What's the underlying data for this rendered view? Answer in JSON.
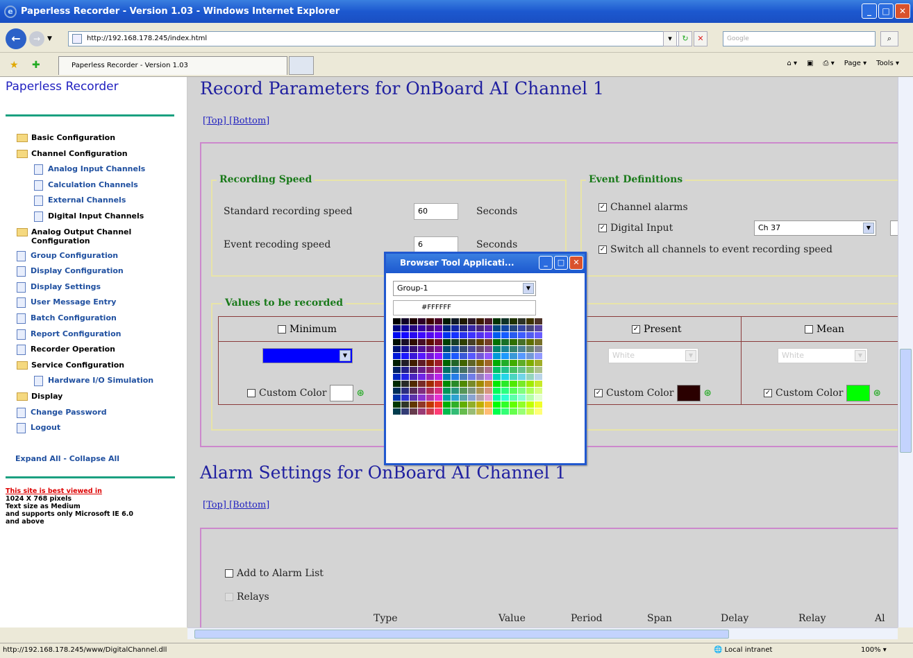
{
  "window": {
    "title": "Paperless Recorder - Version 1.03 - Windows Internet Explorer"
  },
  "address": {
    "url": "http://192.168.178.245/index.html",
    "search_placeholder": "Google"
  },
  "tab": {
    "label": "Paperless Recorder - Version 1.03"
  },
  "commands": {
    "page": "Page",
    "tools": "Tools"
  },
  "sidebar": {
    "title": "Paperless Recorder",
    "items": [
      {
        "label": "Basic Configuration",
        "level": 0,
        "icon": "folder-icon",
        "color": "#000000"
      },
      {
        "label": "Channel Configuration",
        "level": 0,
        "icon": "folder-open-icon",
        "color": "#000000"
      },
      {
        "label": "Analog Input Channels",
        "level": 1,
        "icon": "document-icon",
        "color": "#2050a0"
      },
      {
        "label": "Calculation Channels",
        "level": 1,
        "icon": "document-icon",
        "color": "#2050a0"
      },
      {
        "label": "External Channels",
        "level": 1,
        "icon": "document-icon",
        "color": "#2050a0"
      },
      {
        "label": "Digital Input Channels",
        "level": 1,
        "icon": "document-icon",
        "color": "#000000"
      },
      {
        "label": "Analog Output Channel Configuration",
        "level": 0,
        "icon": "folder-icon",
        "color": "#000000"
      },
      {
        "label": "Group Configuration",
        "level": 0,
        "icon": "document-icon",
        "color": "#2050a0"
      },
      {
        "label": "Display Configuration",
        "level": 0,
        "icon": "document-icon",
        "color": "#2050a0"
      },
      {
        "label": "Display Settings",
        "level": 0,
        "icon": "document-icon",
        "color": "#2050a0"
      },
      {
        "label": "User Message Entry",
        "level": 0,
        "icon": "document-icon",
        "color": "#2050a0"
      },
      {
        "label": "Batch Configuration",
        "level": 0,
        "icon": "document-icon",
        "color": "#2050a0"
      },
      {
        "label": "Report Configuration",
        "level": 0,
        "icon": "document-icon",
        "color": "#2050a0"
      },
      {
        "label": "Recorder Operation",
        "level": 0,
        "icon": "document-icon",
        "color": "#000000"
      },
      {
        "label": "Service Configuration",
        "level": 0,
        "icon": "folder-open-icon",
        "color": "#000000"
      },
      {
        "label": "Hardware I/O Simulation",
        "level": 1,
        "icon": "document-icon",
        "color": "#2050a0"
      },
      {
        "label": "Display",
        "level": 0,
        "icon": "folder-icon",
        "color": "#000000"
      },
      {
        "label": "Change Password",
        "level": 0,
        "icon": "document-icon",
        "color": "#2050a0"
      },
      {
        "label": "Logout",
        "level": 0,
        "icon": "document-icon",
        "color": "#2050a0"
      }
    ],
    "expand_all": "Expand All - Collapse All",
    "note_link": "This site is best viewed in",
    "note_lines": [
      "1024 X 768 pixels",
      "Text size as Medium",
      "and supports only Microsoft IE 6.0",
      "and above"
    ]
  },
  "record": {
    "heading": "Record Parameters for OnBoard AI Channel 1",
    "top_link": "[Top]",
    "bottom_link": "[Bottom]",
    "recording_speed": {
      "legend": "Recording Speed",
      "standard_label": "Standard recording speed",
      "standard_value": "60",
      "standard_unit": "Seconds",
      "event_label": "Event recoding speed",
      "event_value": "6",
      "event_unit": "Seconds"
    },
    "event_definitions": {
      "legend": "Event Definitions",
      "channel_alarms": "Channel alarms",
      "channel_alarms_checked": true,
      "digital_input": "Digital Input",
      "digital_input_checked": true,
      "channel_select": "Ch 37",
      "switch_all": "Switch all channels to event recording speed",
      "switch_all_checked": true
    },
    "values": {
      "legend": "Values to be recorded",
      "columns": [
        {
          "label": "Minimum",
          "checked": false,
          "select": "",
          "custom_color": "Custom Color",
          "custom_checked": false,
          "color": "#ffffff",
          "select_color": "#0000ff"
        },
        {
          "label": "Present",
          "checked": true,
          "select": "White",
          "custom_color": "Custom Color",
          "custom_checked": true,
          "color": "#2a0000"
        },
        {
          "label": "Mean",
          "checked": false,
          "select": "White",
          "custom_color": "Custom Color",
          "custom_checked": true,
          "color": "#00ff00"
        }
      ]
    }
  },
  "alarm": {
    "heading": "Alarm Settings for OnBoard AI Channel 1",
    "top_link": "[Top]",
    "bottom_link": "[Bottom]",
    "add_to_list": "Add to Alarm List",
    "relays": "Relays",
    "columns": [
      "Type",
      "Value",
      "Period",
      "Span",
      "Delay",
      "Relay",
      "Al"
    ]
  },
  "popup": {
    "title": "Browser Tool Applicati...",
    "group_select": "Group-1",
    "color_value": "#FFFFFF"
  },
  "status": {
    "url": "http://192.168.178.245/www/DigitalChannel.dll",
    "zone": "Local intranet",
    "zoom": "100%"
  }
}
